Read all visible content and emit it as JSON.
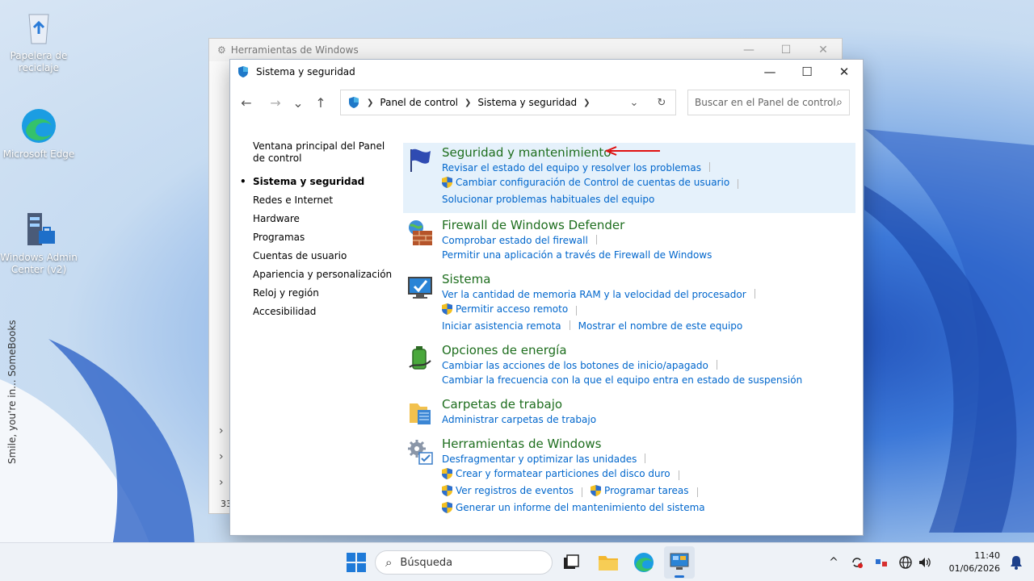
{
  "desktop": {
    "icons": [
      {
        "label": "Papelera de reciclaje",
        "icon": "recycle-bin-icon"
      },
      {
        "label": "Microsoft Edge",
        "icon": "edge-icon"
      },
      {
        "label": "Windows Admin Center (v2)",
        "icon": "admin-center-icon"
      }
    ]
  },
  "back_window": {
    "title": "Herramientas de Windows",
    "controls": [
      "—",
      "☐",
      "✕"
    ],
    "footer_text": "33"
  },
  "window": {
    "title": "Sistema y seguridad",
    "controls": {
      "minimize": "—",
      "maximize": "☐",
      "close": "✕"
    },
    "nav": {
      "back": "←",
      "forward": "→",
      "recent": "⌄",
      "up": "↑"
    },
    "address": {
      "crumbs": [
        "Panel de control",
        "Sistema y seguridad"
      ],
      "dropdown": "⌄",
      "refresh": "↻"
    },
    "search": {
      "placeholder": "Buscar en el Panel de control",
      "icon": "⌕"
    },
    "sidebar": {
      "home": "Ventana principal del Panel de control",
      "items": [
        {
          "label": "Sistema y seguridad",
          "active": true
        },
        {
          "label": "Redes e Internet"
        },
        {
          "label": "Hardware"
        },
        {
          "label": "Programas"
        },
        {
          "label": "Cuentas de usuario"
        },
        {
          "label": "Apariencia y personalización"
        },
        {
          "label": "Reloj y región"
        },
        {
          "label": "Accesibilidad"
        }
      ]
    },
    "categories": [
      {
        "title": "Seguridad y mantenimiento",
        "icon": "flag-icon",
        "links": [
          "Revisar el estado del equipo y resolver los problemas",
          "Cambiar configuración de Control de cuentas de usuario",
          "Solucionar problemas habituales del equipo"
        ]
      },
      {
        "title": "Firewall de Windows Defender",
        "icon": "firewall-icon",
        "links": [
          "Comprobar estado del firewall",
          "Permitir una aplicación a través de Firewall de Windows"
        ]
      },
      {
        "title": "Sistema",
        "icon": "system-monitor-icon",
        "links": [
          "Ver la cantidad de memoria RAM y la velocidad del procesador",
          "Permitir acceso remoto",
          "Iniciar asistencia remota",
          "Mostrar el nombre de este equipo"
        ]
      },
      {
        "title": "Opciones de energía",
        "icon": "power-options-icon",
        "links": [
          "Cambiar las acciones de los botones de inicio/apagado",
          "Cambiar la frecuencia con la que el equipo entra en estado de suspensión"
        ]
      },
      {
        "title": "Carpetas de trabajo",
        "icon": "work-folders-icon",
        "links": [
          "Administrar carpetas de trabajo"
        ]
      },
      {
        "title": "Herramientas de Windows",
        "icon": "gears-icon",
        "links": [
          "Desfragmentar y optimizar las unidades",
          "Crear y formatear particiones del disco duro",
          "Ver registros de eventos",
          "Programar tareas",
          "Generar un informe del mantenimiento del sistema"
        ]
      }
    ]
  },
  "taskbar": {
    "search_placeholder": "Búsqueda",
    "tray_chevron": "^",
    "time": "11:40",
    "date": "01/06/2026"
  },
  "watermark": "Smile, you're in... SomeBooks"
}
